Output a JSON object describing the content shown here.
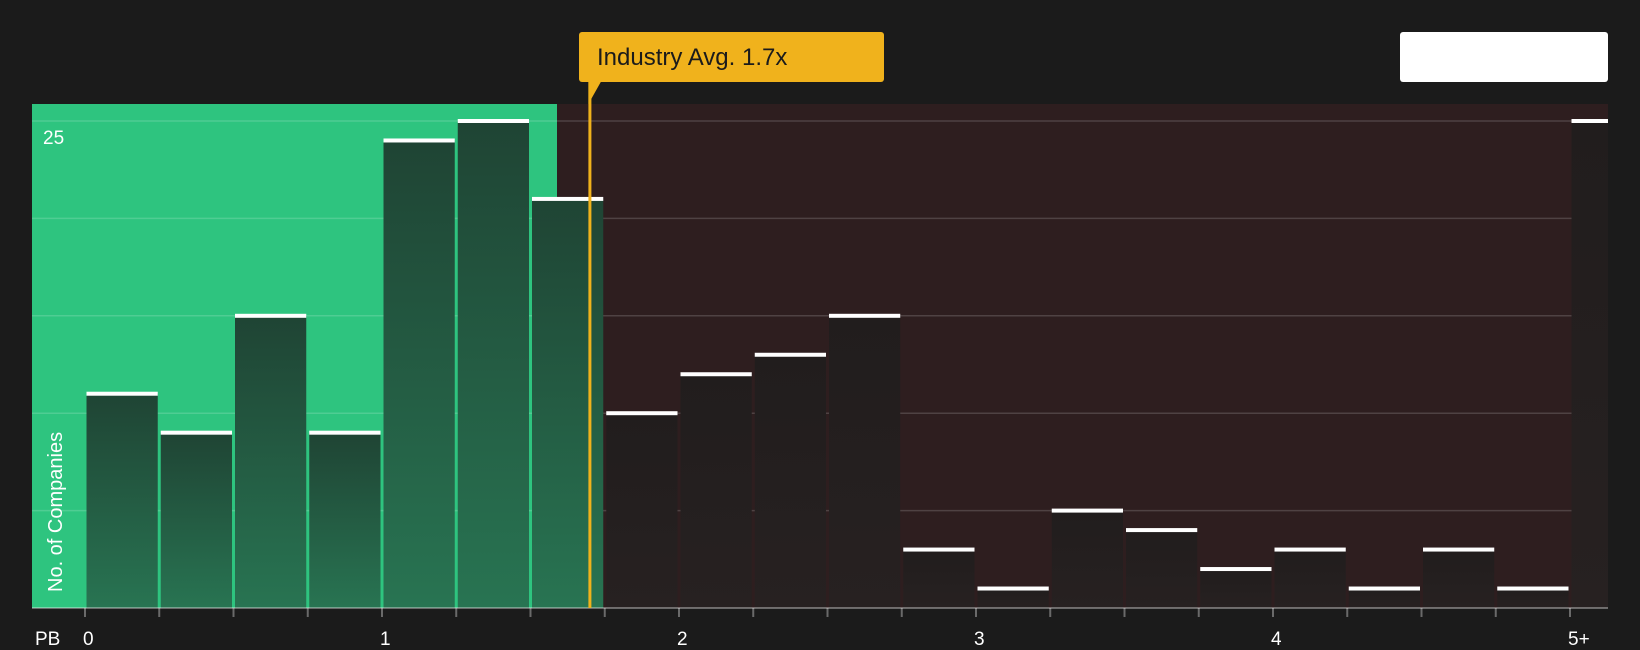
{
  "chart_data": {
    "type": "bar",
    "x_prefix": "PB",
    "ylabel": "No. of Companies",
    "ylim": [
      0,
      25
    ],
    "y_tick_labels": [
      "25"
    ],
    "x_tick_labels": [
      "0",
      "1",
      "2",
      "3",
      "4",
      "5+"
    ],
    "bin_width": 0.25,
    "bins_start": [
      0,
      0.25,
      0.5,
      0.75,
      1.0,
      1.25,
      1.5,
      1.75,
      2.0,
      2.25,
      2.5,
      2.75,
      3.0,
      3.25,
      3.5,
      3.75,
      4.0,
      4.25,
      4.5,
      4.75
    ],
    "values": [
      11,
      9,
      15,
      9,
      24,
      25,
      21,
      10,
      12,
      13,
      15,
      3,
      1,
      5,
      4,
      2,
      3,
      1,
      3,
      1
    ],
    "overflow_bin": {
      "label": "5+",
      "value": 25
    },
    "industry_avg": {
      "label": "Industry Avg. 1.7x",
      "value": 1.7
    },
    "colors": {
      "background": "#1b1b1b",
      "below_avg_region": "#2ec47f",
      "above_avg_region": "#2e1e1f",
      "avg_marker": "#f0b21c",
      "bar_cap": "#ffffff",
      "bar_below": "#1f4a36",
      "bar_above": "#232121"
    },
    "grid": true
  }
}
